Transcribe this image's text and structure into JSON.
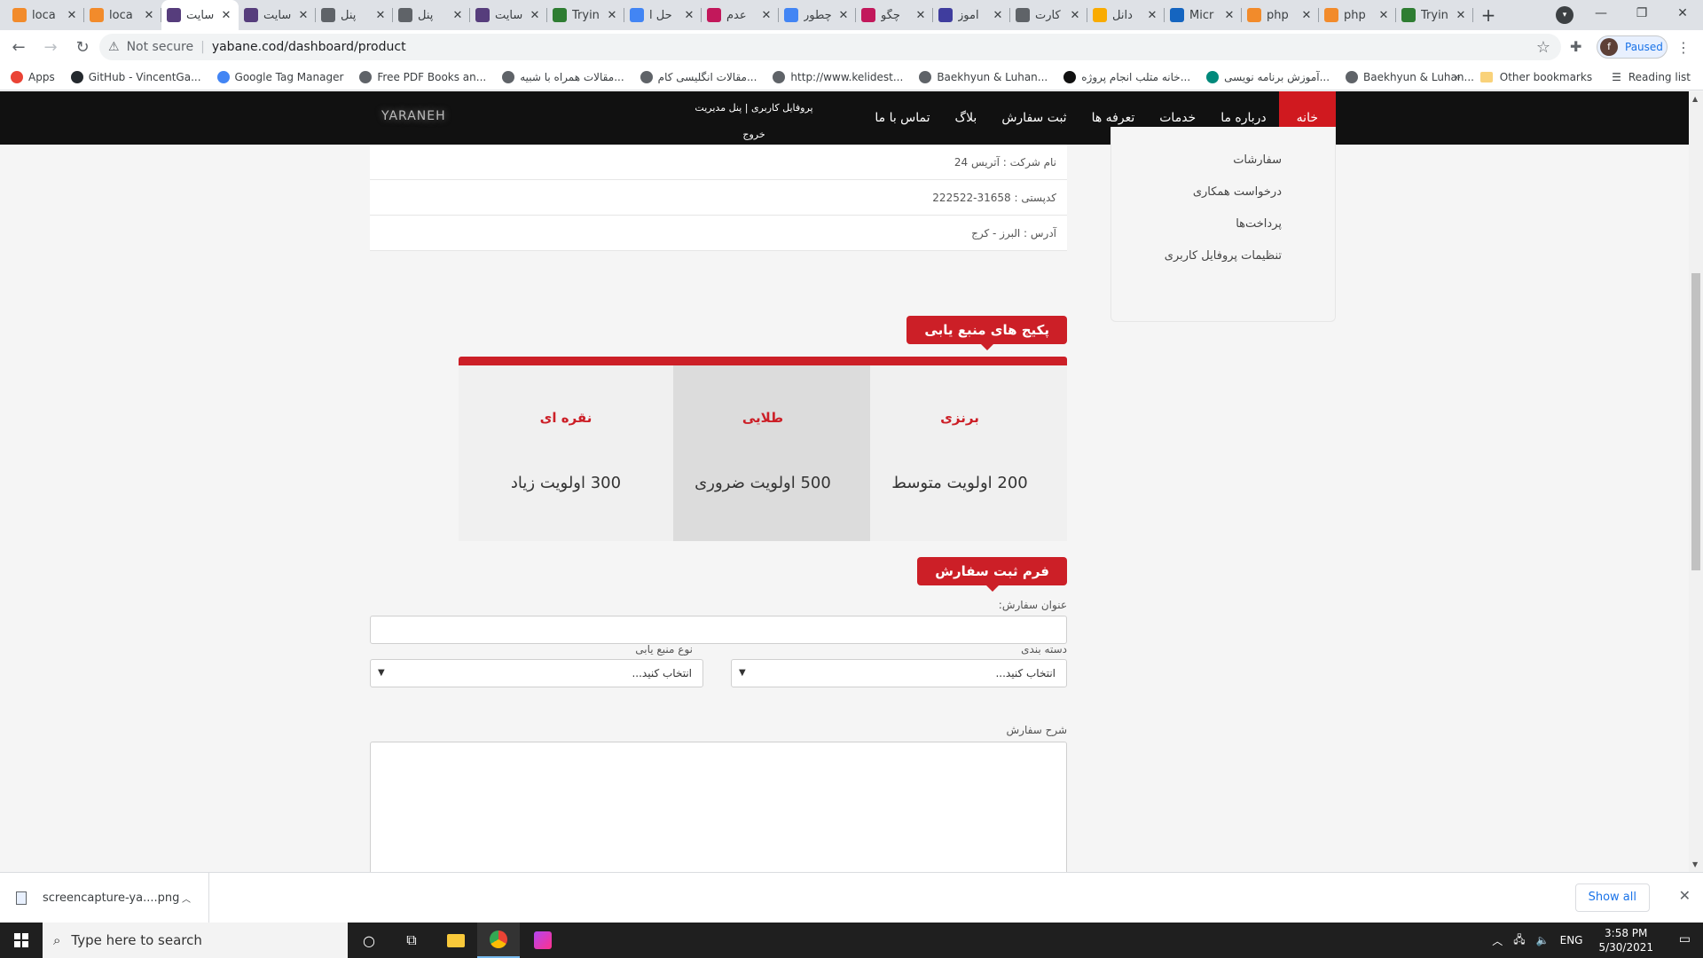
{
  "browser": {
    "tabs": [
      {
        "label": "loca",
        "favicon_color": "#f28b2b",
        "active": false
      },
      {
        "label": "loca",
        "favicon_color": "#f28b2b",
        "active": false
      },
      {
        "label": "سایت",
        "favicon_color": "#563d7c",
        "active": true
      },
      {
        "label": "سایت",
        "favicon_color": "#563d7c",
        "active": false
      },
      {
        "label": "پنل",
        "favicon_color": "#5f6368",
        "active": false
      },
      {
        "label": "پنل",
        "favicon_color": "#5f6368",
        "active": false
      },
      {
        "label": "سایت",
        "favicon_color": "#563d7c",
        "active": false
      },
      {
        "label": "Tryin",
        "favicon_color": "#2e7d32",
        "active": false
      },
      {
        "label": "حل ا",
        "favicon_color": "#4285f4",
        "active": false
      },
      {
        "label": "عدم",
        "favicon_color": "#c2185b",
        "active": false
      },
      {
        "label": "چطور",
        "favicon_color": "#4285f4",
        "active": false
      },
      {
        "label": "چگو",
        "favicon_color": "#c2185b",
        "active": false
      },
      {
        "label": "آموز",
        "favicon_color": "#3f3d9e",
        "active": false
      },
      {
        "label": "کارت",
        "favicon_color": "#5f6368",
        "active": false
      },
      {
        "label": "دانل",
        "favicon_color": "#f9ab00",
        "active": false
      },
      {
        "label": "Micr",
        "favicon_color": "#1565c0",
        "active": false
      },
      {
        "label": "php",
        "favicon_color": "#f28b2b",
        "active": false
      },
      {
        "label": "php",
        "favicon_color": "#f28b2b",
        "active": false
      },
      {
        "label": "Tryin",
        "favicon_color": "#2e7d32",
        "active": false
      }
    ],
    "new_tab": "+",
    "close_glyph": "✕",
    "address": {
      "security": "Not secure",
      "separator": "|",
      "url": "yabane.cod/dashboard/product"
    },
    "profile": {
      "initial": "f",
      "status": "Paused"
    },
    "bookmarks": [
      {
        "label": "Apps",
        "icon_color": "#ea4335"
      },
      {
        "label": "GitHub - VincentGa...",
        "icon_color": "#24292e"
      },
      {
        "label": "Google Tag Manager",
        "icon_color": "#4285f4"
      },
      {
        "label": "Free PDF Books an...",
        "icon_color": "#5f6368"
      },
      {
        "label": "مقالات همراه با شبیه...",
        "icon_color": "#5f6368"
      },
      {
        "label": "مقالات انگلیسی کام...",
        "icon_color": "#5f6368"
      },
      {
        "label": "http://www.kelidest...",
        "icon_color": "#5f6368"
      },
      {
        "label": "Baekhyun & Luhan...",
        "icon_color": "#5f6368"
      },
      {
        "label": "خانه متلب انجام پروژه...",
        "icon_color": "#111111"
      },
      {
        "label": "آموزش برنامه نویسی...",
        "icon_color": "#00897b"
      },
      {
        "label": "Baekhyun & Luhan...",
        "icon_color": "#5f6368"
      }
    ],
    "bookmarks_overflow": "»",
    "other_bookmarks": "Other bookmarks",
    "reading_list": "Reading list"
  },
  "site": {
    "logo": "YARANEH",
    "user_links": [
      "پروفایل کاربری | پنل مدیریت",
      "خروج"
    ],
    "nav": [
      {
        "label": "خانه",
        "active": true
      },
      {
        "label": "درباره ما",
        "active": false
      },
      {
        "label": "خدمات",
        "active": false
      },
      {
        "label": "تعرفه ها",
        "active": false
      },
      {
        "label": "ثبت سفارش",
        "active": false
      },
      {
        "label": "بلاگ",
        "active": false
      },
      {
        "label": "تماس با ما",
        "active": false
      }
    ],
    "info_rows": [
      "نام شرکت : آتریس 24",
      "کدپستی : 31658-222522",
      "آدرس : البرز - کرج"
    ],
    "packages_title": "پکیج های منبع یابی",
    "packages": [
      {
        "name": "برنزی",
        "desc": "200 اولویت متوسط",
        "selected": false
      },
      {
        "name": "طلایی",
        "desc": "500 اولویت ضروری",
        "selected": true
      },
      {
        "name": "نقره ای",
        "desc": "300 اولویت زیاد",
        "selected": false
      }
    ],
    "form": {
      "title": "فرم ثبت سفارش",
      "order_title_label": "عنوان سفارش:",
      "order_title_value": "",
      "category_label": "دسته بندی",
      "category_value": "انتخاب کنید...",
      "source_type_label": "نوع منبع یابی",
      "source_type_value": "انتخاب کنید...",
      "description_label": "شرح سفارش",
      "description_value": ""
    },
    "sidebar": [
      "سفارشات",
      "درخواست همکاری",
      "پرداخت‌ها",
      "تنظیمات پروفایل کاربری"
    ]
  },
  "downloads": {
    "file": "screencapture-ya....png",
    "show_all": "Show all"
  },
  "taskbar": {
    "search_placeholder": "Type here to search",
    "language": "ENG",
    "time": "3:58 PM",
    "date": "5/30/2021"
  }
}
